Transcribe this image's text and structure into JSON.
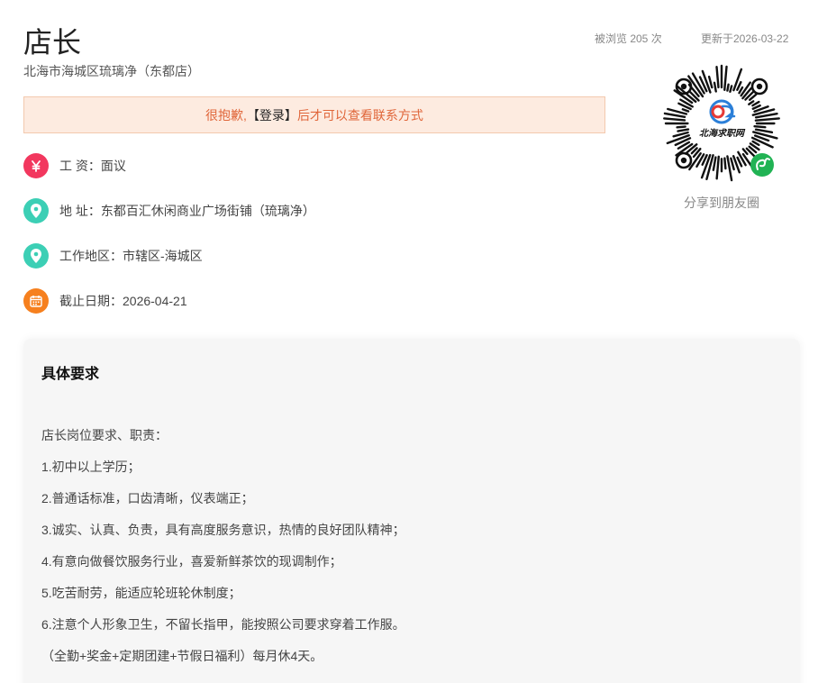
{
  "job": {
    "title": "店长",
    "company": "北海市海城区琉璃净（东都店）",
    "views": "被浏览 205 次",
    "updated": "更新于2026-03-22"
  },
  "login_notice": {
    "prefix": "很抱歉,",
    "link": "【登录】",
    "suffix": "后才可以查看联系方式"
  },
  "info": [
    {
      "icon": "yen-icon",
      "text": "工 资：面议",
      "color": "#f2375e"
    },
    {
      "icon": "location-pin-icon",
      "text": "地 址：东都百汇休闲商业广场街铺（琉璃净）",
      "color": "#3ccfb5"
    },
    {
      "icon": "location-pin-icon",
      "text": "工作地区：市辖区-海城区",
      "color": "#3ccfb5"
    },
    {
      "icon": "calendar-icon",
      "text": "截止日期：2026-04-21",
      "color": "#f6801e"
    }
  ],
  "qr": {
    "logo_text": "北海求职网",
    "caption": "分享到朋友圈"
  },
  "requirements": {
    "title": "具体要求",
    "lines": [
      "店长岗位要求、职责：",
      "1.初中以上学历；",
      "2.普通话标准，口齿清晰，仪表端正；",
      "3.诚实、认真、负责，具有高度服务意识，热情的良好团队精神；",
      "4.有意向做餐饮服务行业，喜爱新鲜茶饮的现调制作；",
      "5.吃苦耐劳，能适应轮班轮休制度；",
      "6.注意个人形象卫生，不留长指甲，能按照公司要求穿着工作服。",
      "（全勤+奖金+定期团建+节假日福利）每月休4天。"
    ]
  }
}
